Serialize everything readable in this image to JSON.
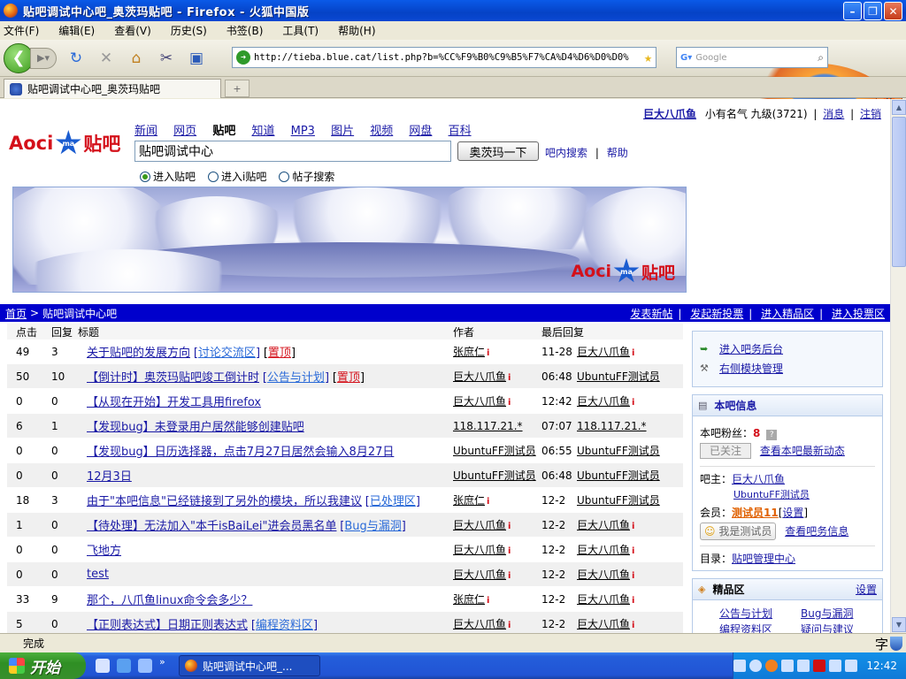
{
  "window": {
    "title": "贴吧调试中心吧_奥茨玛贴吧 - Firefox - 火狐中国版"
  },
  "menu": [
    "文件(F)",
    "编辑(E)",
    "查看(V)",
    "历史(S)",
    "书签(B)",
    "工具(T)",
    "帮助(H)"
  ],
  "browser": {
    "url": "http://tieba.blue.cat/list.php?b=%CC%F9%B0%C9%B5%F7%CA%D4%D6%D0%D0%",
    "search_placeholder": "Google",
    "tab_title": "贴吧调试中心吧_奥茨玛贴吧"
  },
  "userbar": {
    "name": "巨大八爪鱼",
    "fame": "小有名气 九级(3721)",
    "msg": "消息",
    "logout": "注销"
  },
  "logo": {
    "aoci": "Aoci",
    "ma": "ma",
    "tieba": "贴吧"
  },
  "channels": [
    "新闻",
    "网页",
    "贴吧",
    "知道",
    "MP3",
    "图片",
    "视频",
    "网盘",
    "百科"
  ],
  "search": {
    "value": "贴吧调试中心",
    "button": "奥茨玛一下",
    "inbar": "吧内搜索",
    "help": "帮助"
  },
  "radios": [
    "进入贴吧",
    "进入i贴吧",
    "帖子搜索"
  ],
  "navstrip": {
    "home": "首页",
    "crumb": "贴吧调试中心吧",
    "links": [
      "发表新帖",
      "发起新投票",
      "进入精品区",
      "进入投票区"
    ]
  },
  "table": {
    "headers": [
      "点击",
      "回复",
      "标题",
      "作者",
      "最后回复"
    ],
    "rows": [
      {
        "clicks": "49",
        "replies": "3",
        "title": "关于贴吧的发展方向",
        "cat": "讨论交流区",
        "top": "置顶",
        "author": "张庶仁",
        "author_i": true,
        "time": "11-28",
        "last": "巨大八爪鱼",
        "last_i": true
      },
      {
        "clicks": "50",
        "replies": "10",
        "title": "【倒计时】奥茨玛贴吧竣工倒计时",
        "cat": "公告与计划",
        "top": "置顶",
        "author": "巨大八爪鱼",
        "author_i": true,
        "time": "06:48",
        "last": "UbuntuFF测试员",
        "last_i": false
      },
      {
        "clicks": "0",
        "replies": "0",
        "title": "【从现在开始】开发工具用firefox",
        "cat": "",
        "top": "",
        "author": "巨大八爪鱼",
        "author_i": true,
        "time": "12:42",
        "last": "巨大八爪鱼",
        "last_i": true
      },
      {
        "clicks": "6",
        "replies": "1",
        "title": "【发现bug】未登录用户居然能够创建贴吧",
        "cat": "",
        "top": "",
        "author": "118.117.21.*",
        "author_i": false,
        "time": "07:07",
        "last": "118.117.21.*",
        "last_i": false
      },
      {
        "clicks": "0",
        "replies": "0",
        "title": "【发现bug】日历选择器，点击7月27日居然会输入8月27日",
        "cat": "",
        "top": "",
        "author": "UbuntuFF测试员",
        "author_i": false,
        "time": "06:55",
        "last": "UbuntuFF测试员",
        "last_i": false
      },
      {
        "clicks": "0",
        "replies": "0",
        "title": "12月3日",
        "cat": "",
        "top": "",
        "author": "UbuntuFF测试员",
        "author_i": false,
        "time": "06:48",
        "last": "UbuntuFF测试员",
        "last_i": false
      },
      {
        "clicks": "18",
        "replies": "3",
        "title": "由于\"本吧信息\"已经链接到了另外的模块，所以我建议",
        "cat": "已处理区",
        "top": "",
        "author": "张庶仁",
        "author_i": true,
        "time": "12-2",
        "last": "UbuntuFF测试员",
        "last_i": false
      },
      {
        "clicks": "1",
        "replies": "0",
        "title": "【待处理】无法加入\"本千isBaiLei\"进会员黑名单",
        "cat": "Bug与漏洞",
        "top": "",
        "author": "巨大八爪鱼",
        "author_i": true,
        "time": "12-2",
        "last": "巨大八爪鱼",
        "last_i": true
      },
      {
        "clicks": "0",
        "replies": "0",
        "title": "飞地方",
        "cat": "",
        "top": "",
        "author": "巨大八爪鱼",
        "author_i": true,
        "time": "12-2",
        "last": "巨大八爪鱼",
        "last_i": true
      },
      {
        "clicks": "0",
        "replies": "0",
        "title": "test",
        "cat": "",
        "top": "",
        "author": "巨大八爪鱼",
        "author_i": true,
        "time": "12-2",
        "last": "巨大八爪鱼",
        "last_i": true
      },
      {
        "clicks": "33",
        "replies": "9",
        "title": "那个，八爪鱼linux命令会多少？",
        "cat": "",
        "top": "",
        "author": "张庶仁",
        "author_i": true,
        "time": "12-2",
        "last": "巨大八爪鱼",
        "last_i": true
      },
      {
        "clicks": "5",
        "replies": "0",
        "title": "【正则表达式】日期正则表达式",
        "cat": "编程资料区",
        "top": "",
        "author": "巨大八爪鱼",
        "author_i": true,
        "time": "12-2",
        "last": "巨大八爪鱼",
        "last_i": true
      }
    ]
  },
  "sidebar": {
    "admin": [
      "进入吧务后台",
      "右侧模块管理"
    ],
    "info": {
      "title": "本吧信息",
      "fans_label": "本吧粉丝：",
      "fans_count": "8",
      "follow_btn": "已关注",
      "latest": "查看本吧最新动态",
      "owner_label": "吧主：",
      "owner1": "巨大八爪鱼",
      "owner2": "UbuntuFF测试员",
      "member_label": "会员：",
      "member": "测试员11",
      "set": "设置",
      "iam_btn": "我是测试员",
      "viewinfo": "查看吧务信息",
      "dir_label": "目录：",
      "dir": "贴吧管理中心"
    },
    "elite": {
      "title": "精品区",
      "set": "设置",
      "cats": [
        "公告与计划",
        "Bug与漏洞",
        "编程资料区",
        "疑问与建议"
      ]
    }
  },
  "status": {
    "text": "完成",
    "ime": "字"
  },
  "taskbar": {
    "start": "开始",
    "task": "贴吧调试中心吧_...",
    "time": "12:42"
  }
}
